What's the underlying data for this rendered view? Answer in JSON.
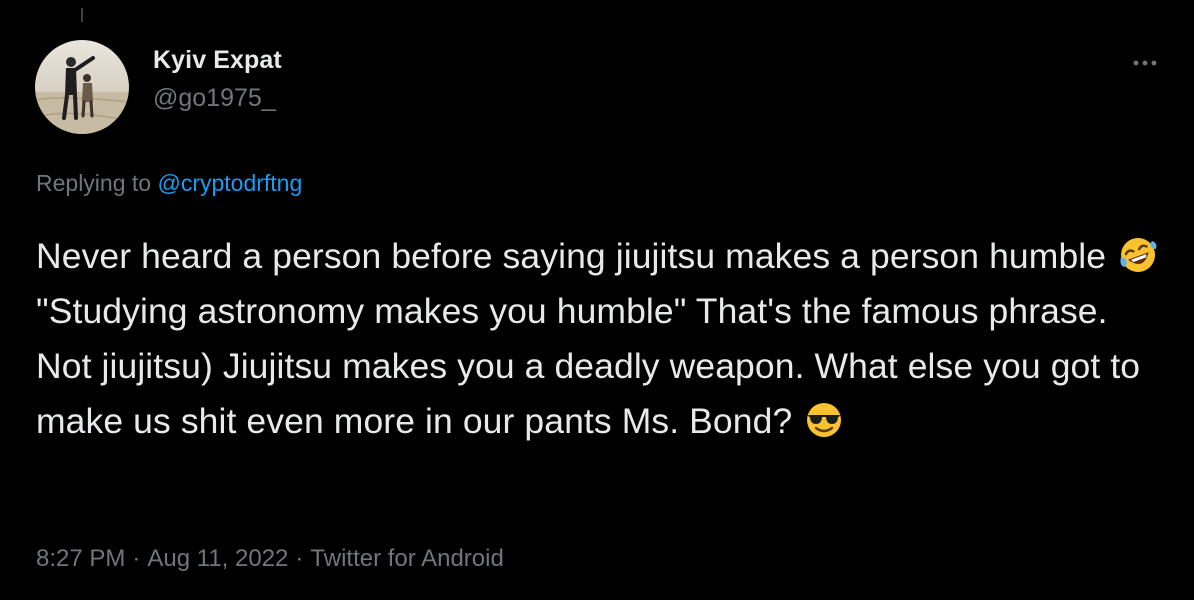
{
  "tweet": {
    "author": {
      "name": "Kyiv Expat",
      "handle": "@go1975_",
      "avatar": "beach-photo"
    },
    "more_icon": "ellipsis-icon",
    "reply": {
      "prefix": "Replying to",
      "mention": "@cryptodrftng"
    },
    "text": {
      "part1": "Never heard a person before saying jiujitsu makes a person humble",
      "emoji1": "rolling-on-floor-laughing-emoji",
      "part2": "\"Studying astronomy makes you humble\" That's the famous phrase. Not jiujitsu) Jiujitsu makes you a deadly weapon. What else you got to make us shit even more in our pants Ms. Bond?",
      "emoji2": "smiling-face-with-sunglasses-emoji"
    },
    "meta": {
      "time": "8:27 PM",
      "date": "Aug 11, 2022",
      "source": "Twitter for Android",
      "separator": "·"
    }
  },
  "colors": {
    "background": "#000000",
    "primary_text": "#e7e9ea",
    "secondary_text": "#71767b",
    "link": "#1d9bf0"
  }
}
